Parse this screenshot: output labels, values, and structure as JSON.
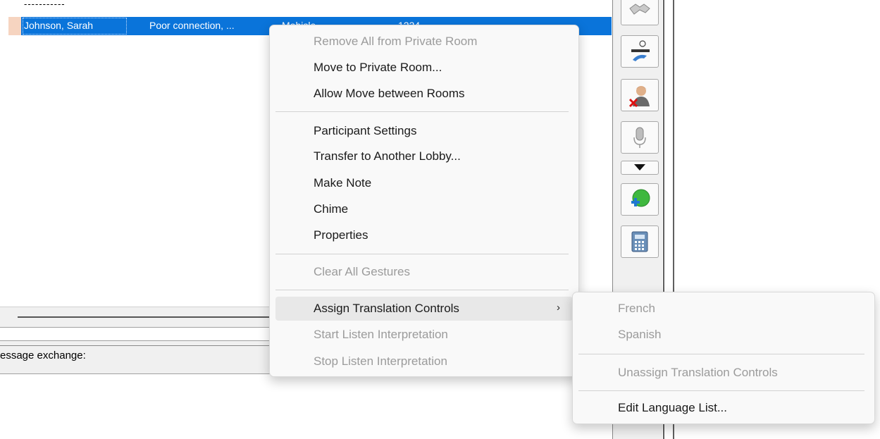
{
  "list": {
    "dashes": "-----------",
    "selected_row": {
      "name": "Johnson, Sarah",
      "note": "Poor connection, ...",
      "col3": "Mobisle",
      "col4": "1234"
    }
  },
  "message_label": "essage exchange:",
  "context_menu": {
    "items": [
      {
        "label": "Remove All from Private Room",
        "enabled": false
      },
      {
        "label": "Move to Private Room...",
        "enabled": true
      },
      {
        "label": "Allow Move between Rooms",
        "enabled": true
      },
      {
        "label": "Participant Settings",
        "enabled": true
      },
      {
        "label": "Transfer to Another Lobby...",
        "enabled": true
      },
      {
        "label": "Make Note",
        "enabled": true
      },
      {
        "label": "Chime",
        "enabled": true
      },
      {
        "label": "Properties",
        "enabled": true
      },
      {
        "label": "Clear All Gestures",
        "enabled": false
      },
      {
        "label": "Assign Translation Controls",
        "enabled": true,
        "submenu_arrow": "›"
      },
      {
        "label": "Start Listen Interpretation",
        "enabled": false
      },
      {
        "label": "Stop Listen Interpretation",
        "enabled": false
      }
    ]
  },
  "submenu": {
    "items": [
      {
        "label": "French",
        "enabled": false
      },
      {
        "label": "Spanish",
        "enabled": false
      },
      {
        "label": "Unassign Translation Controls",
        "enabled": false
      },
      {
        "label": "Edit Language List...",
        "enabled": true
      }
    ]
  },
  "toolbar": {
    "buttons": [
      {
        "icon": "handshake-icon"
      },
      {
        "icon": "phone-transfer-icon"
      },
      {
        "icon": "remove-participant-icon"
      },
      {
        "icon": "microphone-icon"
      },
      {
        "icon": "dropdown-arrow-icon"
      },
      {
        "icon": "add-green-icon"
      },
      {
        "icon": "desk-phone-icon"
      }
    ]
  },
  "colors": {
    "selection": "#0a74da",
    "menu_bg": "#f9f9f9",
    "disabled_text": "#9b9b9b"
  }
}
